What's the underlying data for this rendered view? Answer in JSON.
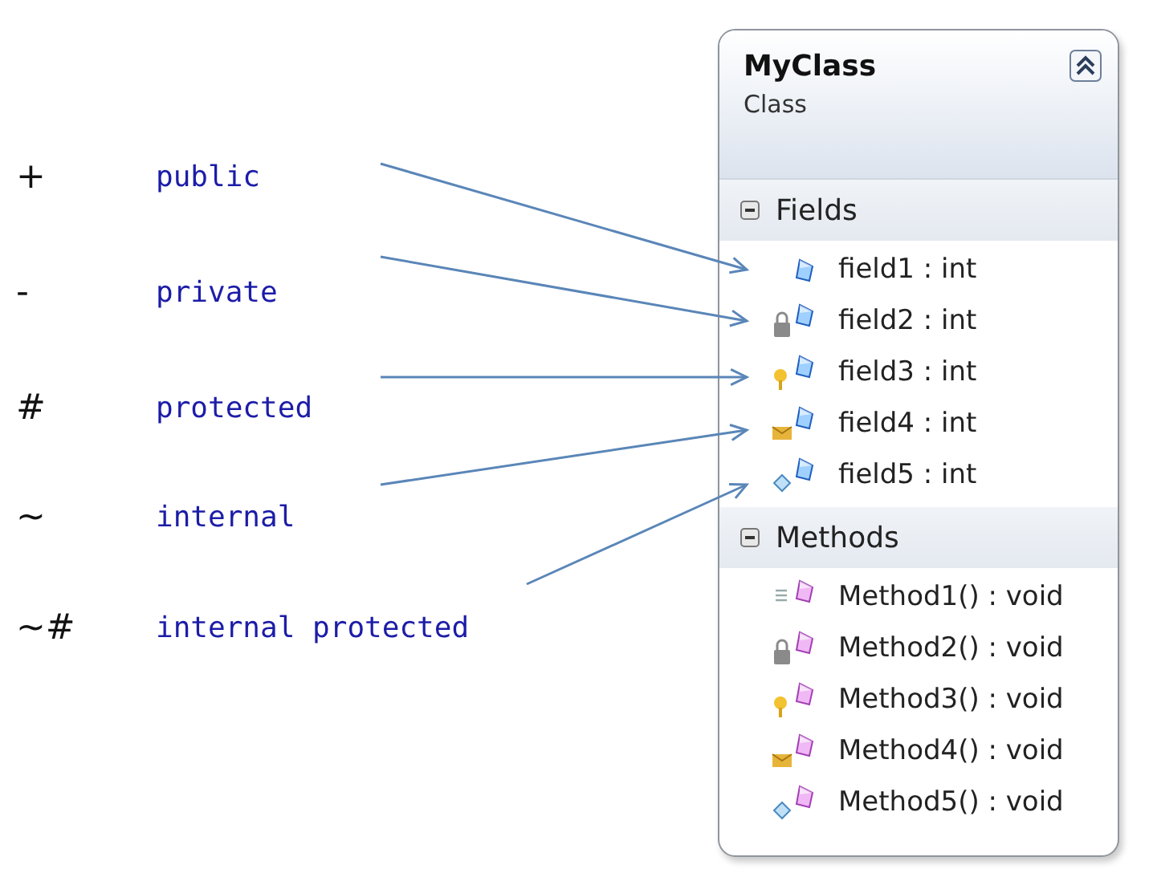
{
  "legend": [
    {
      "symbol": "+",
      "keyword": "public"
    },
    {
      "symbol": "-",
      "keyword": "private"
    },
    {
      "symbol": "#",
      "keyword": "protected"
    },
    {
      "symbol": "~",
      "keyword": "internal"
    },
    {
      "symbol": "~#",
      "keyword": "internal protected"
    }
  ],
  "class_shape": {
    "name": "MyClass",
    "stereotype": "Class",
    "expanded": true,
    "sections": [
      {
        "title": "Fields",
        "kind": "field",
        "expanded": true,
        "members": [
          {
            "text": "field1 : int",
            "kind": "public"
          },
          {
            "text": "field2 : int",
            "kind": "private"
          },
          {
            "text": "field3 : int",
            "kind": "protected"
          },
          {
            "text": "field4 : int",
            "kind": "internal"
          },
          {
            "text": "field5 : int",
            "kind": "internalprotected"
          }
        ]
      },
      {
        "title": "Methods",
        "kind": "method",
        "expanded": true,
        "members": [
          {
            "text": "Method1() : void",
            "kind": "public"
          },
          {
            "text": "Method2() : void",
            "kind": "private"
          },
          {
            "text": "Method3() : void",
            "kind": "protected"
          },
          {
            "text": "Method4() : void",
            "kind": "internal"
          },
          {
            "text": "Method5() : void",
            "kind": "internalprotected"
          }
        ]
      }
    ]
  }
}
